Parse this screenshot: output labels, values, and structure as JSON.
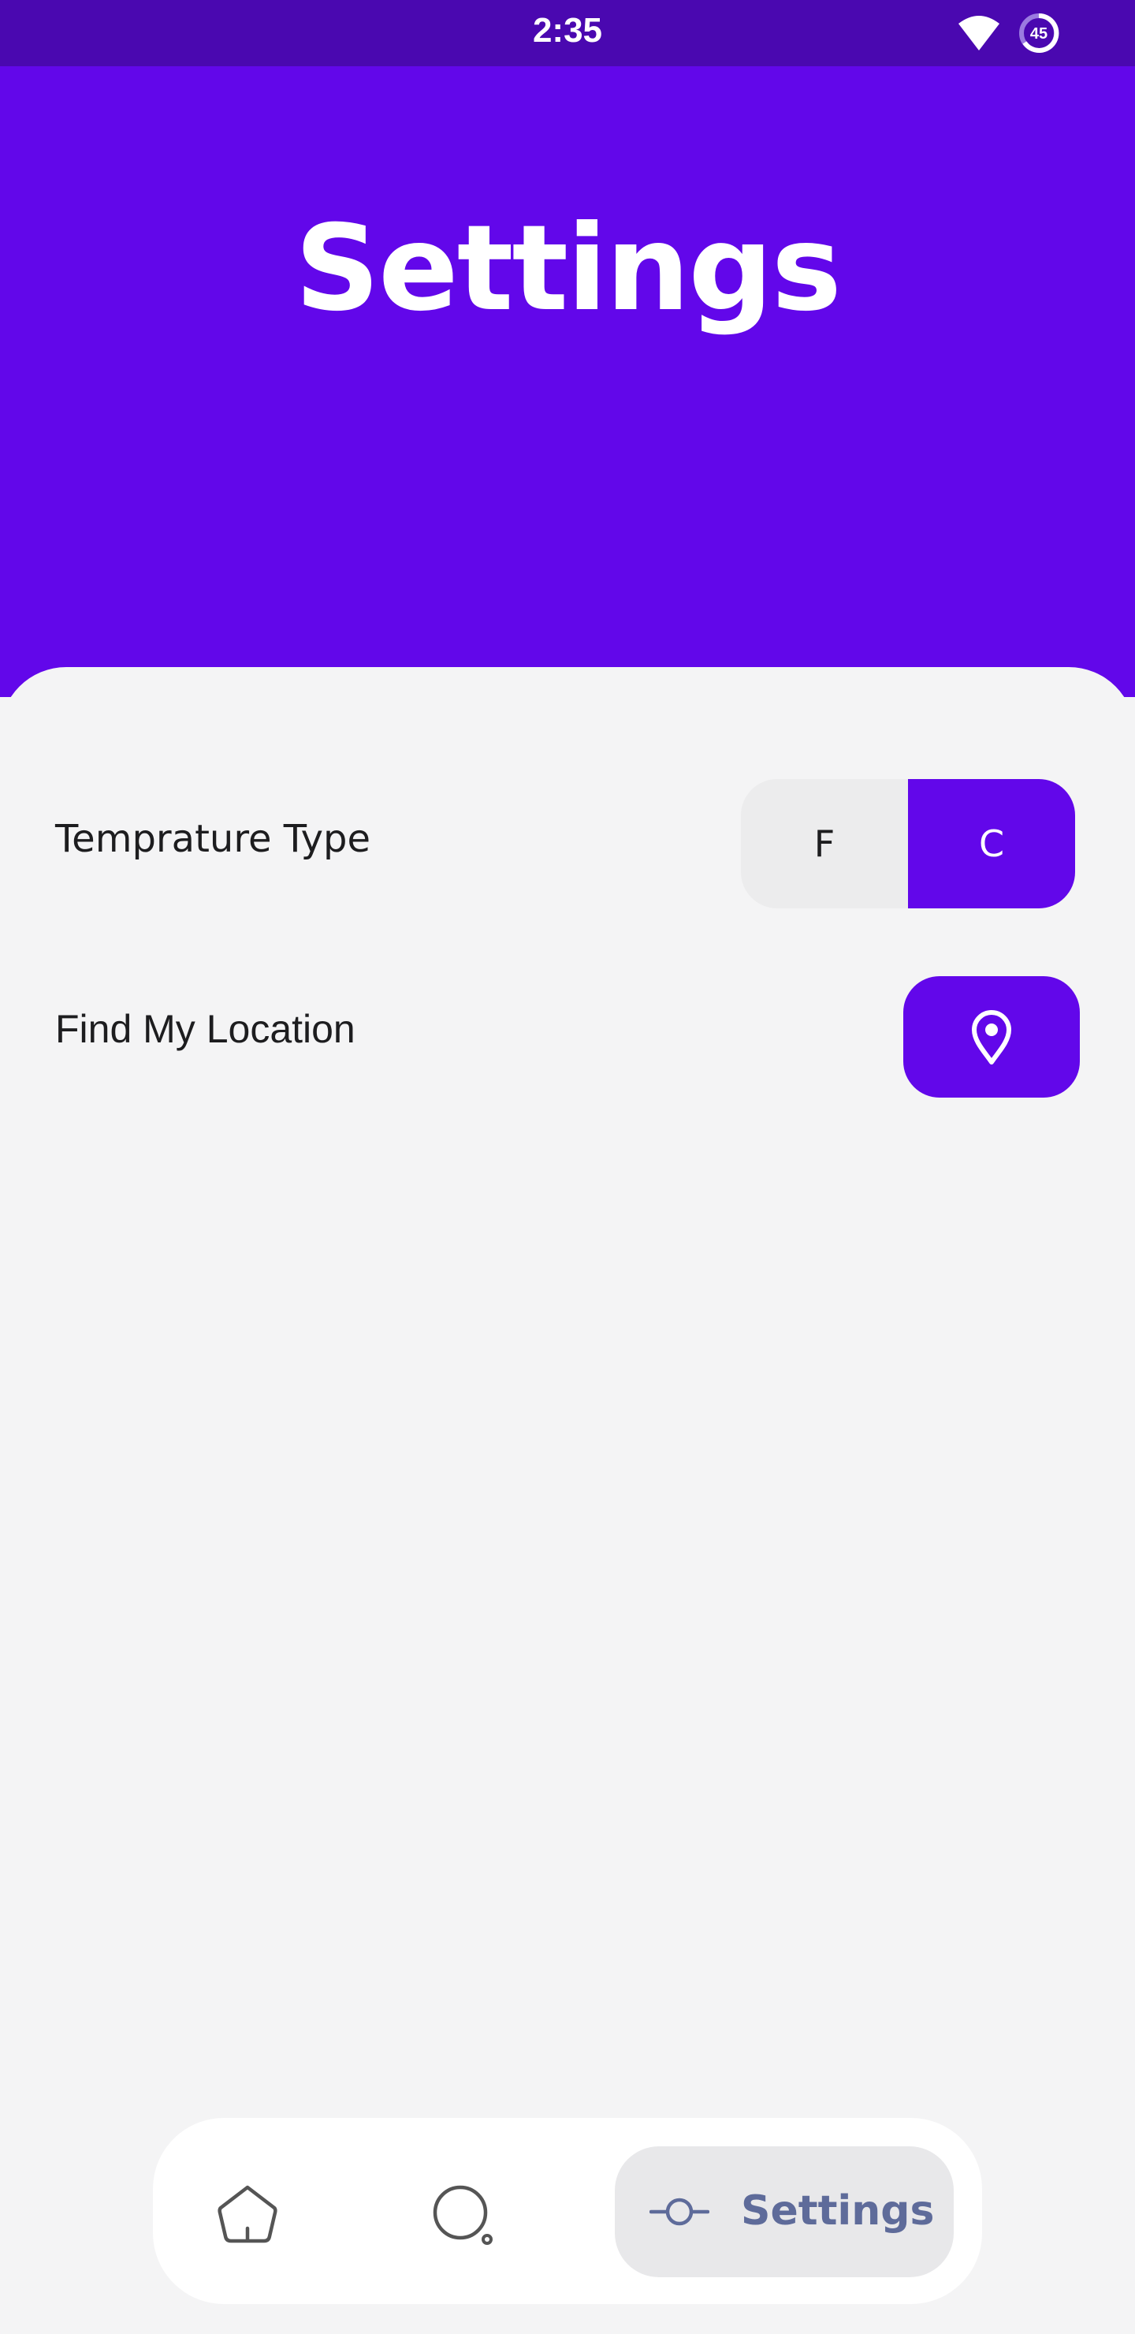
{
  "status_bar": {
    "time": "2:35",
    "battery_level": "45",
    "icons": [
      "wifi-icon",
      "battery-icon"
    ]
  },
  "header": {
    "title": "Settings",
    "color": "#6207ea"
  },
  "settings": {
    "temperature": {
      "label": "Temprature Type",
      "options": [
        "F",
        "C"
      ],
      "selected": "C"
    },
    "location": {
      "label": "Find My Location",
      "icon": "location-pin-icon"
    }
  },
  "bottom_nav": {
    "items": [
      {
        "icon": "home-icon",
        "label": ""
      },
      {
        "icon": "search-icon",
        "label": ""
      },
      {
        "icon": "settings-slider-icon",
        "label": "Settings"
      }
    ],
    "active": "Settings"
  },
  "colors": {
    "accent": "#6207ea",
    "status_bar": "#4a08b0",
    "background": "#f4f4f5",
    "nav_active_text": "#5e6b9a"
  }
}
